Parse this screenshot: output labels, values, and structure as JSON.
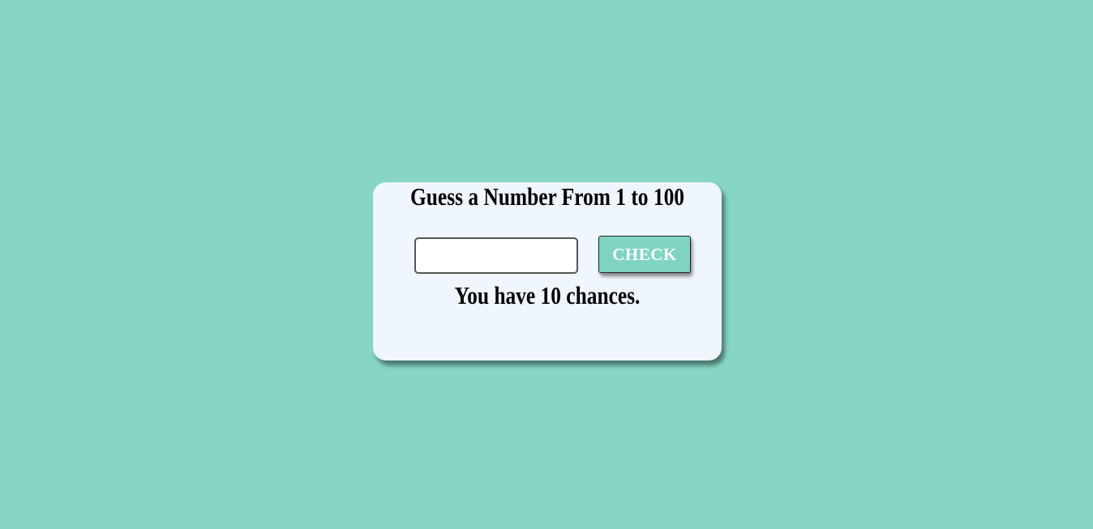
{
  "colors": {
    "background": "#87d6c5",
    "card": "#eff6fe",
    "accent": "#80d4c2",
    "text": "#000000"
  },
  "game": {
    "title": "Guess a Number From 1 to 100",
    "guess_input": {
      "value": "",
      "placeholder": ""
    },
    "check_label": "CHECK",
    "status": "You have 10 chances."
  }
}
